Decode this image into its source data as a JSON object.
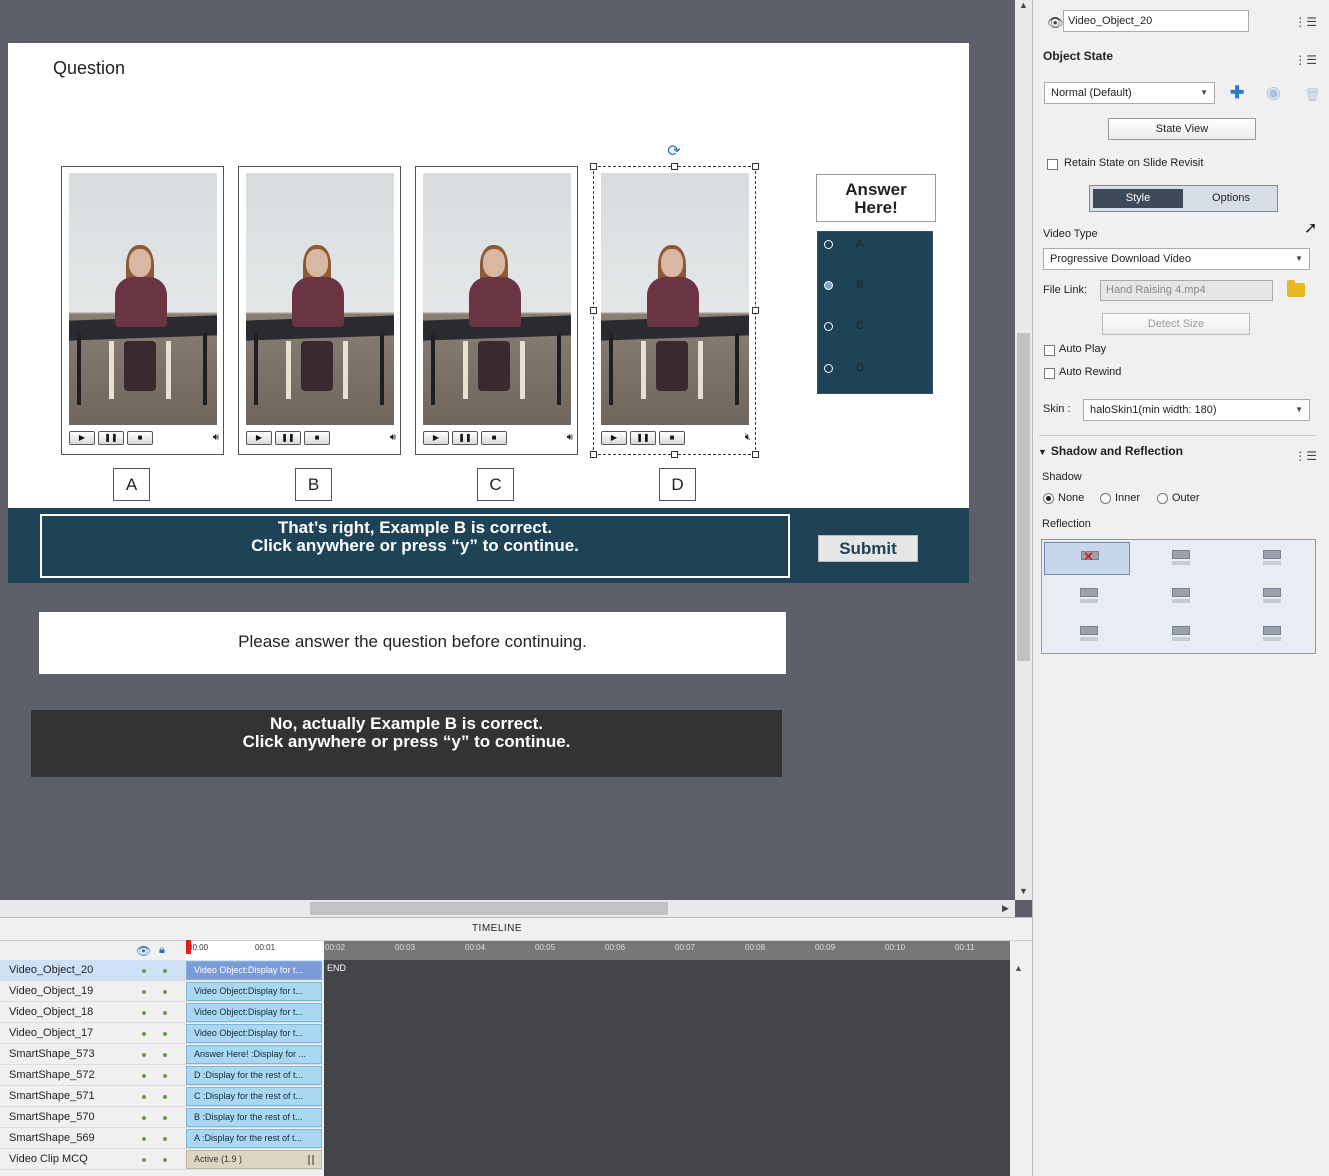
{
  "slide": {
    "title": "Question",
    "answer_here": [
      "Answer",
      "Here!"
    ],
    "options": [
      "A",
      "B",
      "C",
      "D"
    ],
    "selected_option": "B",
    "video_labels": [
      "A",
      "B",
      "C",
      "D"
    ],
    "correct_feedback": [
      "That’s right, Example B is correct.",
      "Click anywhere or press “y” to continue."
    ],
    "submit_label": "Submit",
    "incomplete_message": "Please answer the question before continuing.",
    "incorrect_feedback": [
      "No, actually Example B  is correct.",
      "Click anywhere or press “y” to continue."
    ]
  },
  "timeline": {
    "title": "TIMELINE",
    "ticks": [
      "00:00",
      "00:01",
      "00:02",
      "00:03",
      "00:04",
      "00:05",
      "00:06",
      "00:07",
      "00:08",
      "00:09",
      "00:10",
      "00:11"
    ],
    "end_label": "END",
    "rows": [
      {
        "name": "Video_Object_20",
        "bar": "Video Object:Display for t...",
        "selected": true
      },
      {
        "name": "Video_Object_19",
        "bar": "Video Object:Display for t..."
      },
      {
        "name": "Video_Object_18",
        "bar": "Video Object:Display for t..."
      },
      {
        "name": "Video_Object_17",
        "bar": "Video Object:Display for t..."
      },
      {
        "name": "SmartShape_573",
        "bar": "Answer  Here! :Display for ..."
      },
      {
        "name": "SmartShape_572",
        "bar": "D :Display for the rest of t..."
      },
      {
        "name": "SmartShape_571",
        "bar": "C :Display for the rest of t..."
      },
      {
        "name": "SmartShape_570",
        "bar": "B :Display for the rest of t..."
      },
      {
        "name": "SmartShape_569",
        "bar": "A :Display for the rest of t..."
      },
      {
        "name": "Video Clip MCQ",
        "bar": "Active (1.9 )",
        "active": true
      }
    ]
  },
  "properties": {
    "object_name": "Video_Object_20",
    "object_state_heading": "Object State",
    "state_value": "Normal (Default)",
    "state_view_label": "State View",
    "retain_state_label": "Retain State on Slide Revisit",
    "tabs": [
      "Style",
      "Options"
    ],
    "video_type_label": "Video Type",
    "video_type_value": "Progressive Download Video",
    "file_link_label": "File Link:",
    "file_link_value": "Hand Raising 4.mp4",
    "detect_size_label": "Detect Size",
    "auto_play_label": "Auto Play",
    "auto_rewind_label": "Auto Rewind",
    "skin_label": "Skin :",
    "skin_value": "haloSkin1(min width: 180)",
    "shadow_reflection_heading": "Shadow and Reflection",
    "shadow_label": "Shadow",
    "shadow_options": [
      "None",
      "Inner",
      "Outer"
    ],
    "shadow_selected": "None",
    "reflection_label": "Reflection"
  },
  "colors": {
    "slide_accent": "#1e4356",
    "stage_bg": "#5d6069",
    "incorrect_bg": "#333333"
  }
}
